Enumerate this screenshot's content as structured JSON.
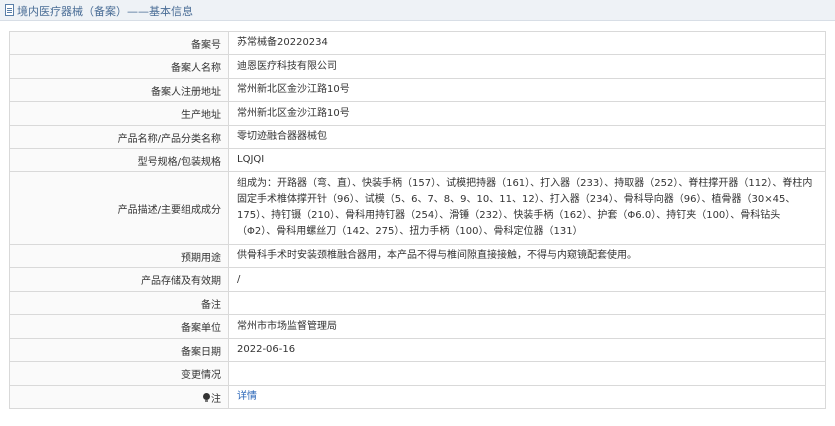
{
  "header": {
    "title": "境内医疗器械（备案）——基本信息"
  },
  "rows": [
    {
      "label": "备案号",
      "value": "苏常械备20220234"
    },
    {
      "label": "备案人名称",
      "value": "迪恩医疗科技有限公司"
    },
    {
      "label": "备案人注册地址",
      "value": "常州新北区金沙江路10号"
    },
    {
      "label": "生产地址",
      "value": "常州新北区金沙江路10号"
    },
    {
      "label": "产品名称/产品分类名称",
      "value": "零切迹融合器器械包"
    },
    {
      "label": "型号规格/包装规格",
      "value": "LQJQⅠ"
    },
    {
      "label": "产品描述/主要组成成分",
      "value": "组成为：开路器（弯、直）、快装手柄（157）、试模把持器（161）、打入器（233）、持取器（252）、脊柱撑开器（112）、脊柱内固定手术椎体撑开针（96）、试模（5、6、7、8、9、10、11、12）、打入器（234）、骨科导向器（96）、植骨器（30×45、175）、持钉镊（210）、骨科用持钉器（254）、滑锤（232）、快装手柄（162）、护套（Φ6.0）、持钉夹（100）、骨科钻头（Φ2）、骨科用螺丝刀（142、275）、扭力手柄（100）、骨科定位器（131）"
    },
    {
      "label": "预期用途",
      "value": "供骨科手术时安装颈椎融合器用，本产品不得与椎间隙直接接触，不得与内窥镜配套使用。"
    },
    {
      "label": "产品存储及有效期",
      "value": "/"
    },
    {
      "label": "备注",
      "value": ""
    },
    {
      "label": "备案单位",
      "value": "常州市市场监督管理局"
    },
    {
      "label": "备案日期",
      "value": "2022-06-16"
    },
    {
      "label": "变更情况",
      "value": ""
    }
  ],
  "detail_row": {
    "label": "注",
    "link": "详情",
    "icon": "bulb-icon"
  }
}
